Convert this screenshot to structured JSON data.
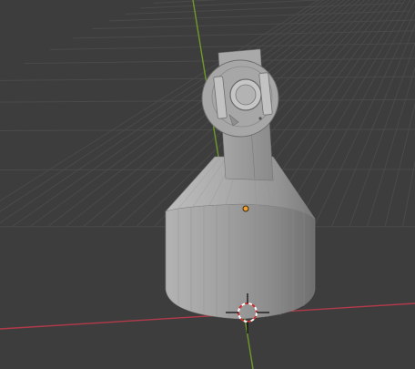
{
  "viewport": {
    "kind": "3D viewport (Blender)",
    "background_color": "#3d3d3d",
    "grid_color": "#4a4a4a",
    "x_axis_color": "#b23a4a",
    "y_axis_color": "#6f9a2a"
  },
  "scene": {
    "object_color": "#9b9b9b",
    "origin_color": "#f0a030",
    "cursor_colors": [
      "#d03030",
      "#ffffff"
    ]
  }
}
